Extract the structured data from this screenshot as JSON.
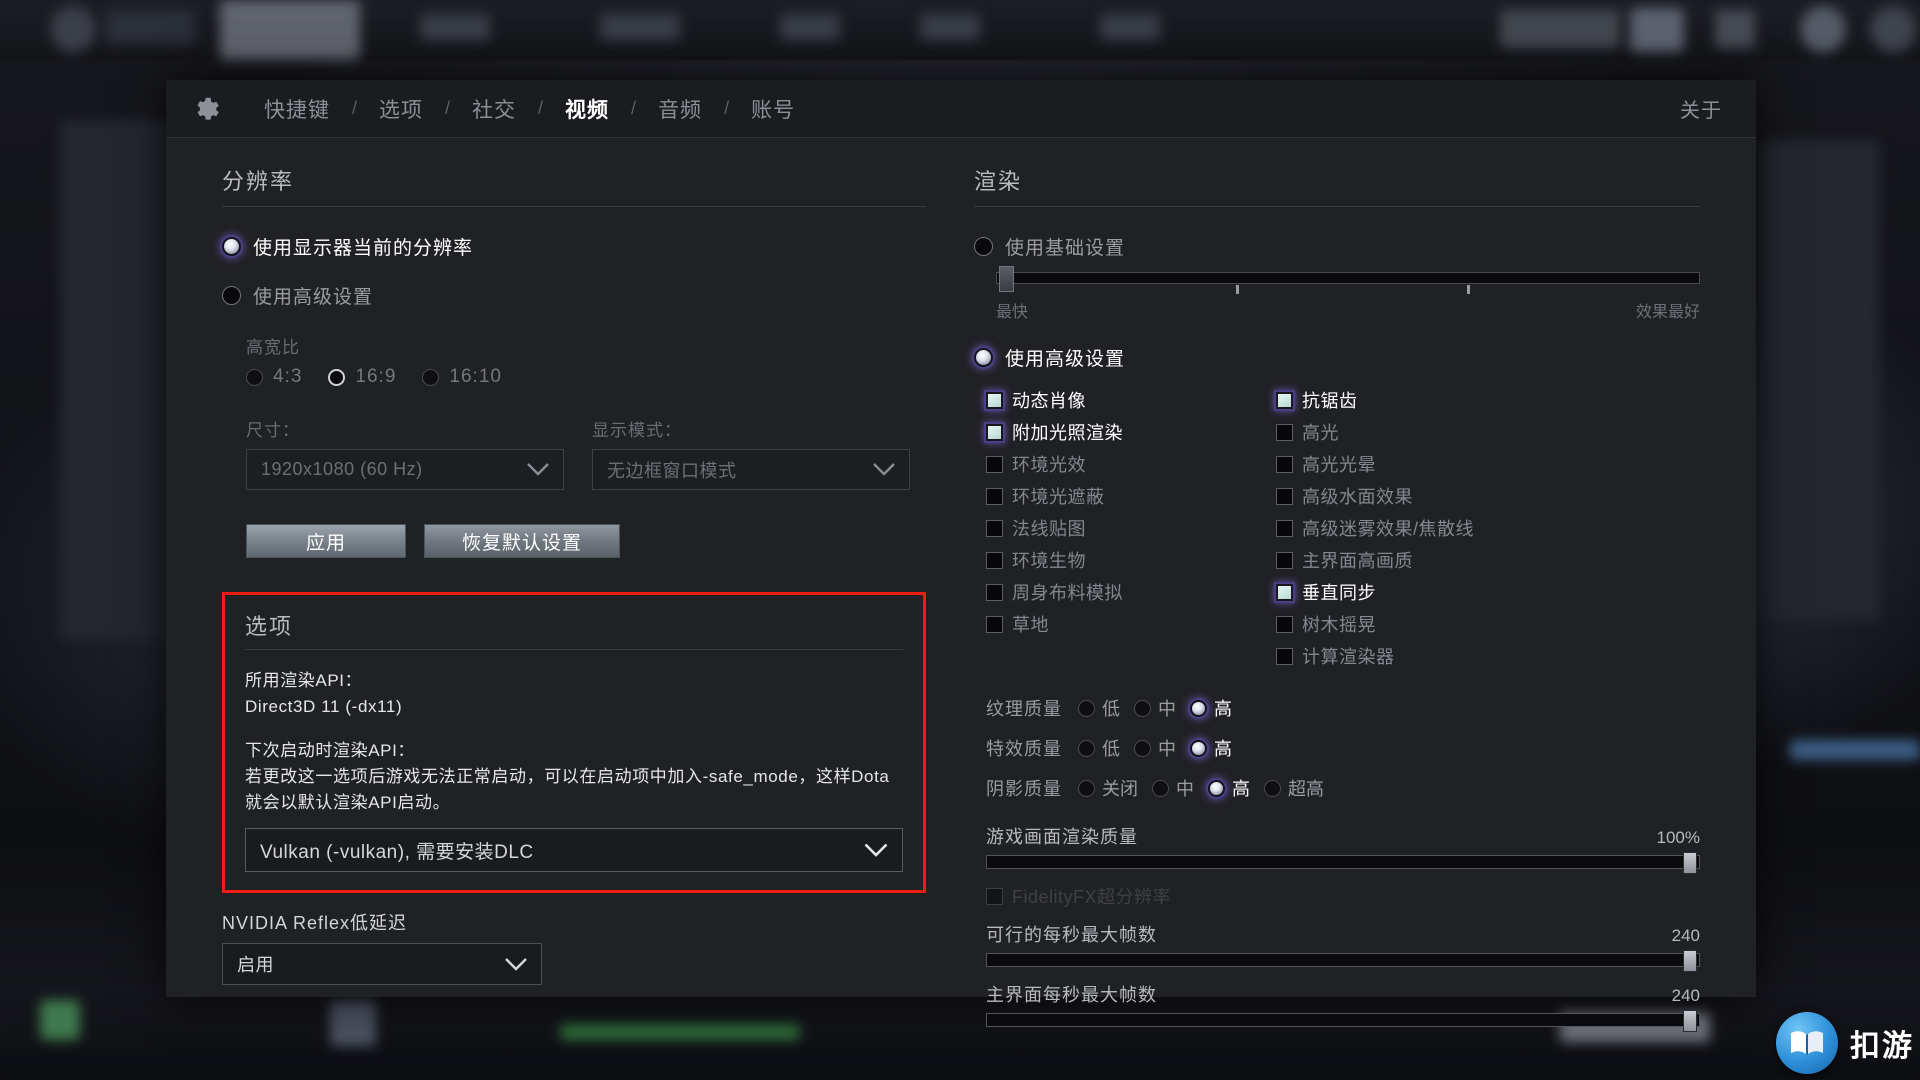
{
  "window": {
    "gear_icon": "gear-icon",
    "about_label": "关于",
    "tabs": [
      {
        "label": "快捷键",
        "active": false
      },
      {
        "label": "选项",
        "active": false
      },
      {
        "label": "社交",
        "active": false
      },
      {
        "label": "视频",
        "active": true
      },
      {
        "label": "音频",
        "active": false
      },
      {
        "label": "账号",
        "active": false
      }
    ],
    "tab_separator": "/"
  },
  "resolution": {
    "section_title": "分辨率",
    "use_current_label": "使用显示器当前的分辨率",
    "use_current_selected": true,
    "use_advanced_label": "使用高级设置",
    "use_advanced_selected": false,
    "aspect_label": "高宽比",
    "aspect_options": [
      {
        "label": "4:3",
        "selected": false
      },
      {
        "label": "16:9",
        "selected": true
      },
      {
        "label": "16:10",
        "selected": false
      }
    ],
    "size_label": "尺寸：",
    "size_value": "1920x1080 (60 Hz)",
    "display_mode_label": "显示模式：",
    "display_mode_value": "无边框窗口模式",
    "apply_button": "应用",
    "reset_button": "恢复默认设置"
  },
  "options": {
    "section_title": "选项",
    "highlight_color": "#ef1c12",
    "current_api_label": "所用渲染API：",
    "current_api_value": "Direct3D 11 (-dx11)",
    "next_api_label": "下次启动时渲染API：",
    "next_api_note_line1": "若更改这一选项后游戏无法正常启动，可以在启动项中加入-safe_mode，这样Dota",
    "next_api_note_line2": "就会以默认渲染API启动。",
    "api_select_value": "Vulkan (-vulkan), 需要安装DLC",
    "reflex_label": "NVIDIA Reflex低延迟",
    "reflex_value": "启用"
  },
  "render": {
    "section_title": "渲染",
    "use_basic_label": "使用基础设置",
    "use_basic_selected": false,
    "basic_slider": {
      "value_pct": 2,
      "ticks_pct": [
        34,
        67
      ],
      "left_caption": "最快",
      "right_caption": "效果最好"
    },
    "use_advanced_label": "使用高级设置",
    "use_advanced_selected": true,
    "checkboxes_left": [
      {
        "label": "动态肖像",
        "checked": true
      },
      {
        "label": "附加光照渲染",
        "checked": true
      },
      {
        "label": "环境光效",
        "checked": false
      },
      {
        "label": "环境光遮蔽",
        "checked": false
      },
      {
        "label": "法线贴图",
        "checked": false
      },
      {
        "label": "环境生物",
        "checked": false
      },
      {
        "label": "周身布料模拟",
        "checked": false
      },
      {
        "label": "草地",
        "checked": false
      }
    ],
    "checkboxes_right": [
      {
        "label": "抗锯齿",
        "checked": true
      },
      {
        "label": "高光",
        "checked": false
      },
      {
        "label": "高光光晕",
        "checked": false
      },
      {
        "label": "高级水面效果",
        "checked": false
      },
      {
        "label": "高级迷雾效果/焦散线",
        "checked": false
      },
      {
        "label": "主界面高画质",
        "checked": false
      },
      {
        "label": "垂直同步",
        "checked": true
      },
      {
        "label": "树木摇晃",
        "checked": false
      },
      {
        "label": "计算渲染器",
        "checked": false
      }
    ],
    "quality_rows": [
      {
        "name": "纹理质量",
        "options": [
          {
            "label": "低",
            "selected": false
          },
          {
            "label": "中",
            "selected": false
          },
          {
            "label": "高",
            "selected": true
          }
        ]
      },
      {
        "name": "特效质量",
        "options": [
          {
            "label": "低",
            "selected": false
          },
          {
            "label": "中",
            "selected": false
          },
          {
            "label": "高",
            "selected": true
          }
        ]
      },
      {
        "name": "阴影质量",
        "options": [
          {
            "label": "关闭",
            "selected": false
          },
          {
            "label": "中",
            "selected": false
          },
          {
            "label": "高",
            "selected": true
          },
          {
            "label": "超高",
            "selected": false
          }
        ]
      }
    ],
    "render_quality": {
      "label": "游戏画面渲染质量",
      "value": "100%",
      "fill_pct": 99
    },
    "fidelityfx": {
      "label": "FidelityFX超分辨率",
      "checked": false,
      "disabled": true
    },
    "max_fps": {
      "label": "可行的每秒最大帧数",
      "value": "240",
      "fill_pct": 99
    },
    "max_fps_ui": {
      "label": "主界面每秒最大帧数",
      "value": "240",
      "fill_pct": 99
    }
  },
  "watermark": {
    "text": "扣游",
    "icon": "book-icon"
  }
}
